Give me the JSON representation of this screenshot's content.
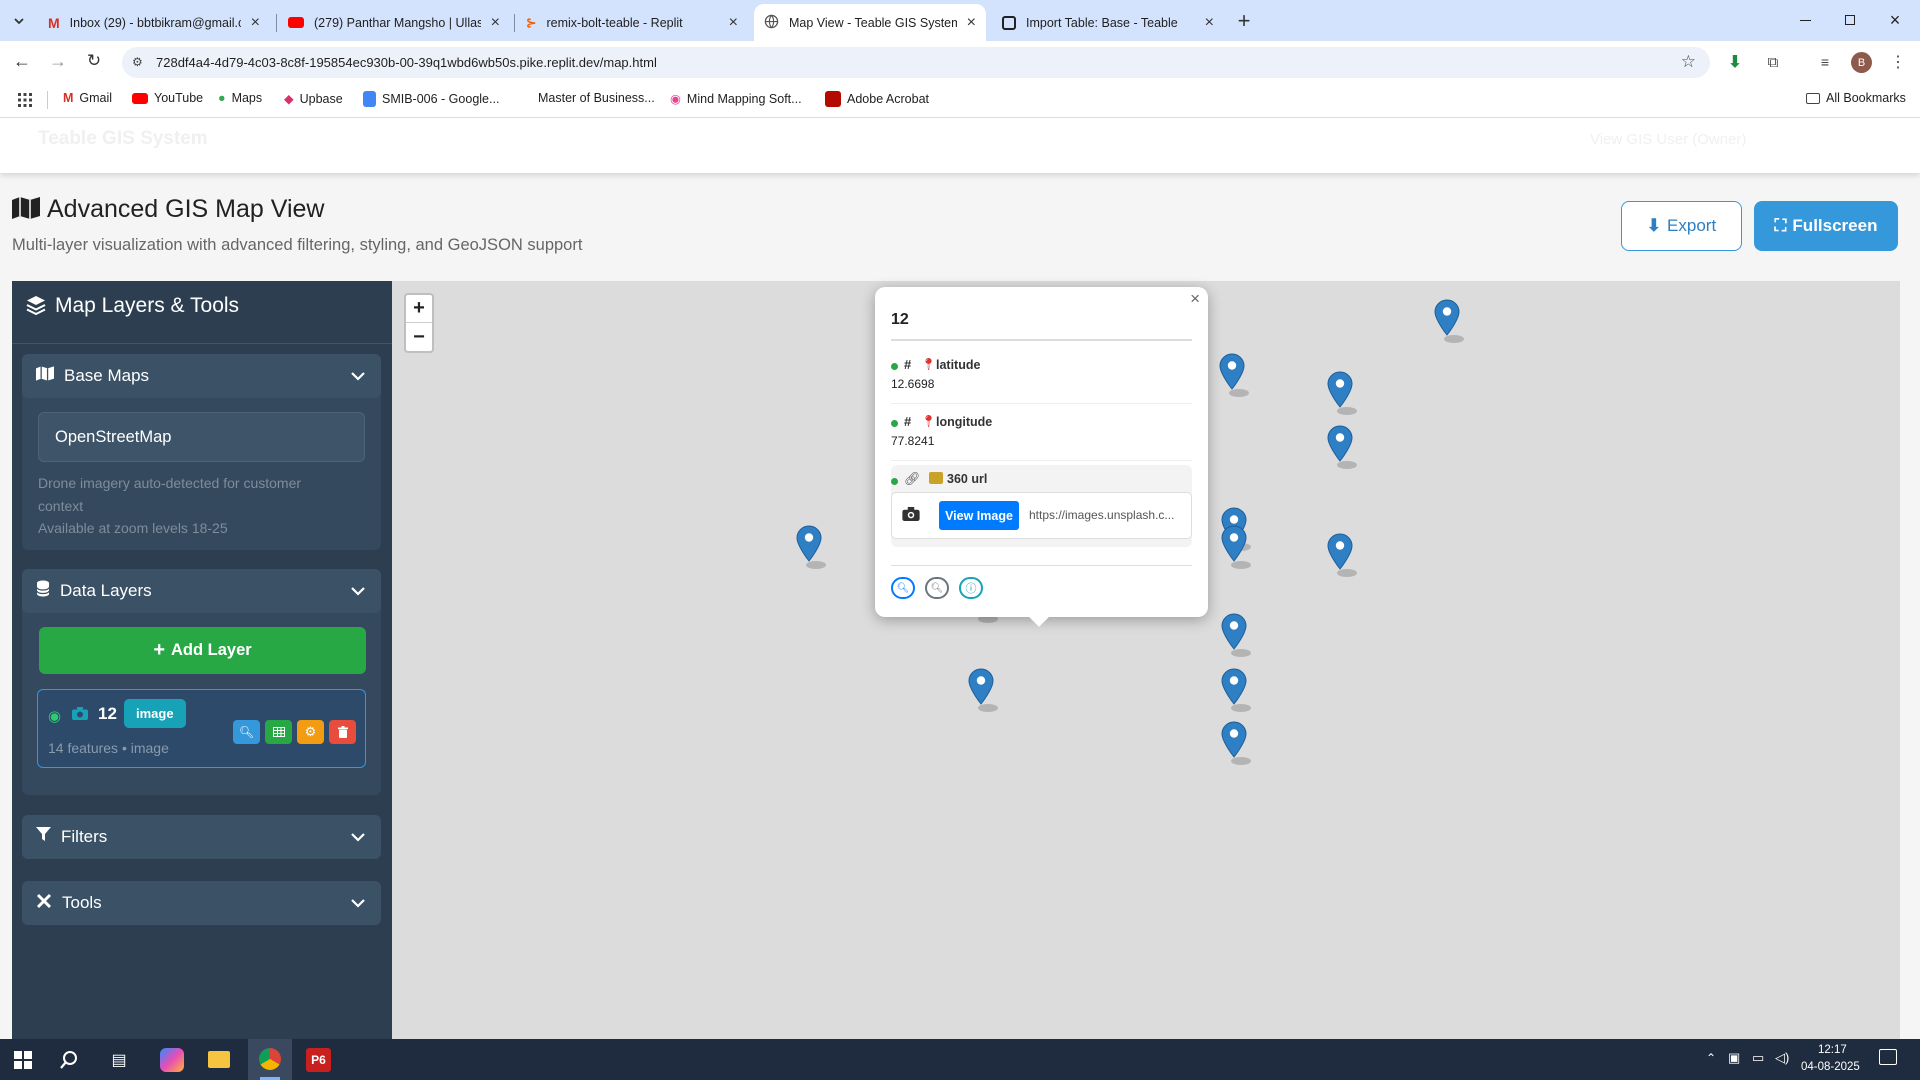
{
  "browser": {
    "tabs": [
      {
        "title": "Inbox (29) - bbtbikram@gmail.c",
        "icon": "gmail-icon"
      },
      {
        "title": "(279) Panthar Mangsho | Ullas M",
        "icon": "youtube-icon"
      },
      {
        "title": "remix-bolt-teable - Replit",
        "icon": "replit-icon"
      },
      {
        "title": "Map View - Teable GIS System",
        "icon": "globe-icon"
      },
      {
        "title": "Import Table: Base - Teable",
        "icon": "teable-icon"
      }
    ],
    "url": "728df4a4-4d79-4c03-8c8f-195854ec930b-00-39q1wbd6wb50s.pike.replit.dev/map.html",
    "bookmarks": [
      "Gmail",
      "YouTube",
      "Maps",
      "Upbase",
      "SMIB-006 - Google...",
      "Master of Business...",
      "Mind Mapping Soft...",
      "Adobe Acrobat"
    ],
    "all_bookmarks": "All Bookmarks",
    "profile_initial": "B"
  },
  "app": {
    "brand": "Teable GIS System",
    "user": "View GIS User (Owner)"
  },
  "header": {
    "title": "Advanced GIS Map View",
    "subtitle": "Multi-layer visualization with advanced filtering, styling, and GeoJSON support",
    "export": "Export",
    "fullscreen": "Fullscreen"
  },
  "sidebar": {
    "title": "Map Layers & Tools",
    "base_maps": {
      "title": "Base Maps",
      "selected": "OpenStreetMap",
      "note1": "Drone imagery auto-detected for customer",
      "note2": "context",
      "note3": "Available at zoom levels 18-25"
    },
    "data_layers": {
      "title": "Data Layers",
      "add": "Add Layer",
      "layer_name": "12",
      "layer_badge": "image",
      "layer_meta": "14 features • image"
    },
    "filters": {
      "title": "Filters"
    },
    "tools": {
      "title": "Tools"
    }
  },
  "map": {
    "zoom_in": "+",
    "zoom_out": "−",
    "popup": {
      "title": "12",
      "f1_label": "latitude",
      "f1_value": "12.6698",
      "f2_label": "longitude",
      "f2_value": "77.8241",
      "f3_label": "360 url",
      "view_image": "View Image",
      "url_text": "https://images.unsplash.c...",
      "close": "×"
    }
  },
  "taskbar": {
    "time": "12:17",
    "date": "04-08-2025"
  },
  "colors": {
    "sidebar": "#2c3e50",
    "accent": "#3498db",
    "green": "#28a745",
    "pin": "#2f7fc4"
  }
}
